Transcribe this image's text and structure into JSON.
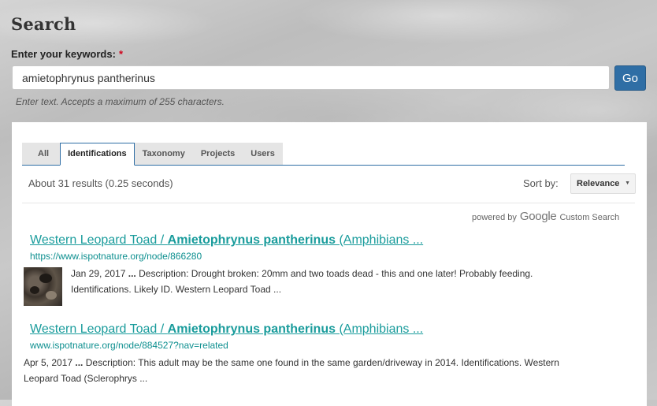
{
  "page": {
    "title": "Search"
  },
  "form": {
    "label": "Enter your keywords:",
    "required_marker": "*",
    "value": "amietophrynus pantherinus",
    "go_label": "Go",
    "help_text": "Enter text. Accepts a maximum of 255 characters."
  },
  "tabs": [
    {
      "label": "All",
      "active": false
    },
    {
      "label": "Identifications",
      "active": true
    },
    {
      "label": "Taxonomy",
      "active": false
    },
    {
      "label": "Projects",
      "active": false
    },
    {
      "label": "Users",
      "active": false
    }
  ],
  "results_summary": "About 31 results (0.25 seconds)",
  "sort": {
    "label": "Sort by:",
    "value": "Relevance"
  },
  "powered_by": {
    "text": "powered by",
    "brand": "Google",
    "suffix": "Custom Search"
  },
  "results": [
    {
      "title_prefix": "Western Leopard Toad / ",
      "title_bold": "Amietophrynus pantherinus",
      "title_suffix": " (Amphibians ...",
      "url": "https://www.ispotnature.org/node/866280",
      "date": "Jan 29, 2017",
      "ellipsis": "...",
      "line1": " Description: Drought broken: 20mm and two toads dead - this and one later! Probably feeding.",
      "line2": "Identifications. Likely ID. Western Leopard Toad ...",
      "has_thumb": true
    },
    {
      "title_prefix": "Western Leopard Toad / ",
      "title_bold": "Amietophrynus pantherinus",
      "title_suffix": " (Amphibians ...",
      "url": "www.ispotnature.org/node/884527?nav=related",
      "date": "Apr 5, 2017",
      "ellipsis": "...",
      "line1": " Description: This adult may be the same one found in the same garden/driveway in 2014. Identifications. Western",
      "line2": "Leopard Toad (Sclerophrys ...",
      "has_thumb": false
    }
  ],
  "colors": {
    "accent": "#2f6ea5",
    "link": "#1a9c9c",
    "url": "#0d8f8f",
    "required": "#d0021b"
  }
}
